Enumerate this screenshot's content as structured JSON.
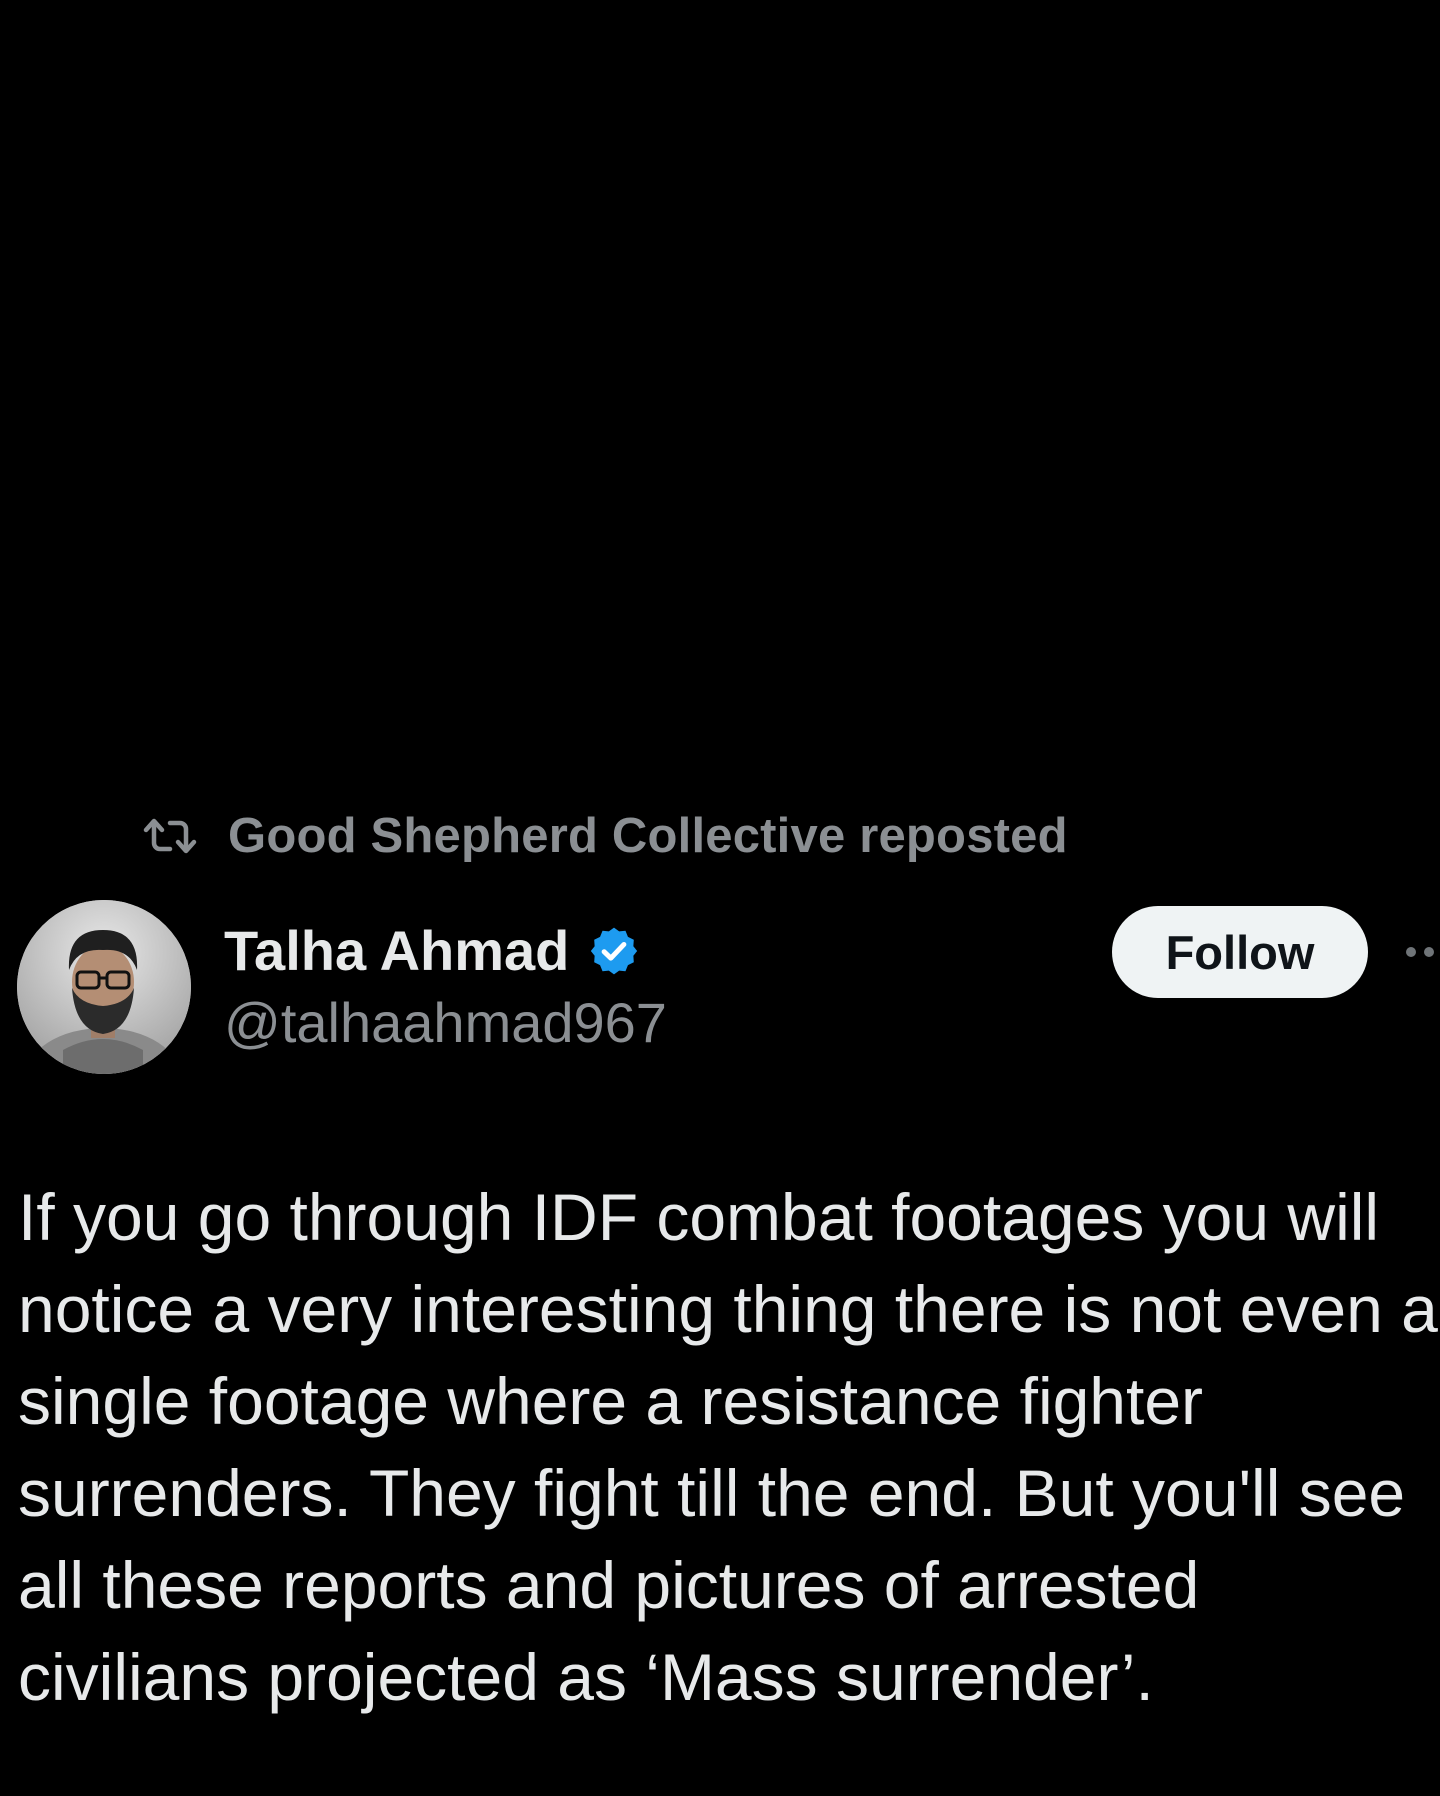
{
  "colors": {
    "background": "#000000",
    "primary_text": "#e7e9ea",
    "secondary_text": "#8b8f93",
    "verified_blue": "#1d9bf0",
    "follow_button_bg": "#eff3f4",
    "follow_button_text": "#0f1419"
  },
  "repost": {
    "icon": "repost-icon",
    "text": "Good Shepherd Collective reposted"
  },
  "author": {
    "avatar": "avatar",
    "display_name": "Talha Ahmad",
    "verified_icon": "verified-badge-icon",
    "handle": "@talhaahmad967"
  },
  "actions": {
    "follow_label": "Follow",
    "more_icon": "more-options-icon"
  },
  "tweet": {
    "lines": [
      "If you go through IDF combat footages you will",
      "notice a very interesting thing there is not even a",
      "single footage where a resistance fighter",
      "surrenders. They fight till the end. But you'll see",
      "all these reports and pictures of arrested",
      "civilians projected as ‘Mass surrender’."
    ]
  }
}
